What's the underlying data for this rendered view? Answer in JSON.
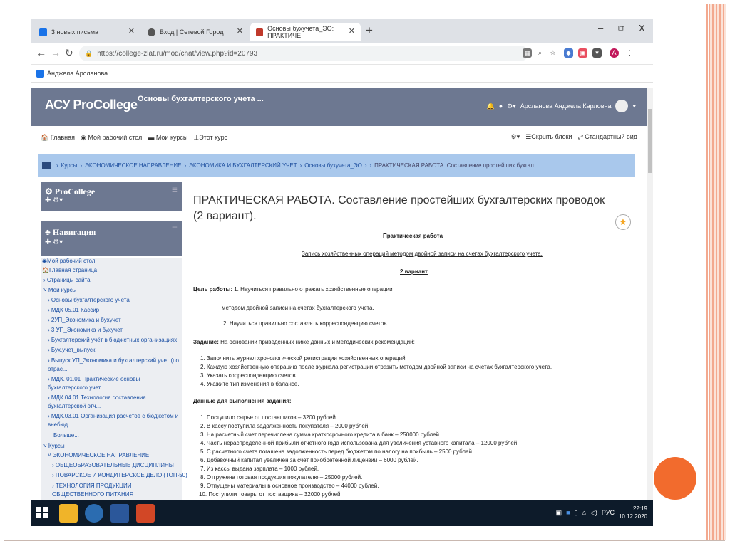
{
  "tabs": [
    {
      "label": "3 новых письма",
      "favicon_color": "#1a73e8"
    },
    {
      "label": "Вход | Сетевой Город",
      "favicon_color": "#555555"
    },
    {
      "label": "Основы бухучета_ЭО: ПРАКТИЧЕ",
      "favicon_color": "#c0392b"
    }
  ],
  "window_controls": {
    "minimize": "–",
    "maximize": "⧉",
    "close": "X"
  },
  "address": {
    "url": "https://college-zlat.ru/mod/chat/view.php?id=20793"
  },
  "bookmarks": {
    "label": "Анджела Арсланова"
  },
  "moodle": {
    "logo": "АСУ ProCollege",
    "course_title": "Основы бухгалтерского учета ...",
    "user_name": "Арсланова Анджела Карловна",
    "nav_links": [
      "Главная",
      "Мой рабочий стол",
      "Мои курсы",
      "Этот курс"
    ],
    "nav_right": [
      "Скрыть блоки",
      "Стандартный вид"
    ],
    "breadcrumb": [
      "Курсы",
      "ЭКОНОМИЧЕСКОЕ НАПРАВЛЕНИЕ",
      "ЭКОНОМИКА И БУХГАЛТЕРСКИЙ УЧЕТ",
      "Основы бухучета_ЭО",
      "ПРАКТИЧЕСКАЯ РАБОТА. Составление простейших бухгал..."
    ]
  },
  "blocks": {
    "procollege": "ProCollege",
    "navigation": "Навигация"
  },
  "nav_items": [
    "Мой рабочий стол",
    "Главная страница",
    "Страницы сайта",
    "Мои курсы",
    "Основы бухгалтерского учета",
    "МДК 05.01 Кассир",
    "2УП_Экономика и бухучет",
    "3 УП_Экономика и бухучет",
    "Бухгалтерский учёт в бюджетных организациях",
    "Бух.учет_выпуск",
    "Выпуск УП_Экономика и бухгалтерский учет (по отрас...",
    "МДК. 01.01 Практические основы бухгалтерского учет...",
    "МДК.04.01 Технология составления бухгалтерской отч...",
    "МДК.03.01 Организация расчетов с бюджетом и внебюд...",
    "Больше...",
    "Курсы",
    "ЭКОНОМИЧЕСКОЕ НАПРАВЛЕНИЕ",
    "ОБЩЕОБРАЗОВАТЕЛЬНЫЕ ДИСЦИПЛИНЫ",
    "ПОВАРСКОЕ И КОНДИТЕРСКОЕ ДЕЛО (ТОП-50)",
    "ТЕХНОЛОГИЯ ПРОДУКЦИИ ОБЩЕСТВЕННОГО ПИТАНИЯ"
  ],
  "content": {
    "page_title": "ПРАКТИЧЕСКАЯ РАБОТА. Составление простейших бухгалтерских проводок (2 вариант).",
    "heading": "Практическая работа",
    "subheading": "Запись хозяйственных операций методом двойной записи на счетах бухгалтерского учета.",
    "variant": "2 вариант",
    "goal_label": "Цель работы:",
    "goal_1": "1. Научиться правильно отражать хозяйственные операции",
    "goal_1b": "методом двойной записи на счетах бухгалтерского учета.",
    "goal_2": "2. Научиться правильно составлять корреспонденцию счетов.",
    "task_label": "Задание:",
    "task_text": "На основании приведенных ниже данных и методических рекомендаций:",
    "tasks": [
      "1. Заполнить журнал хронологической регистрации хозяйственных операций.",
      "2. Каждую хозяйственную операцию после журнала регистрации отразить методом двойной записи на счетах бухгалтерского учета.",
      "3. Указать корреспонденцию счетов.",
      "4. Укажите тип изменения в балансе."
    ],
    "data_label": "Данные для выполнения задания:",
    "data_items": [
      "1. Поступило сырье от поставщиков – 3200 рублей",
      "2. В кассу поступила задолженность покупателя – 2000 рублей.",
      "3. На расчетный счет перечислена сумма краткосрочного кредита в банк – 250000 рублей.",
      "4. Часть нераспределенной прибыли отчетного года использована для увеличения уставного капитала – 12000 рублей.",
      "5. С расчетного счета погашена задолженность перед бюджетом по налогу на прибыль – 2500 рублей.",
      "6. Добавочный капитал увеличен за счет приобретенной лицензии – 6000 рублей.",
      "7. Из кассы выдана зарплата – 1000 рублей.",
      "8. Отгружена готовая продукция покупателю – 25000 рублей.",
      "9. Отпущены материалы в основное производство – 44000 рублей.",
      "10. Поступили товары от поставщика – 32000 рублей."
    ]
  },
  "taskbar": {
    "lang": "РУС",
    "time": "22:19",
    "date": "10.12.2020"
  }
}
